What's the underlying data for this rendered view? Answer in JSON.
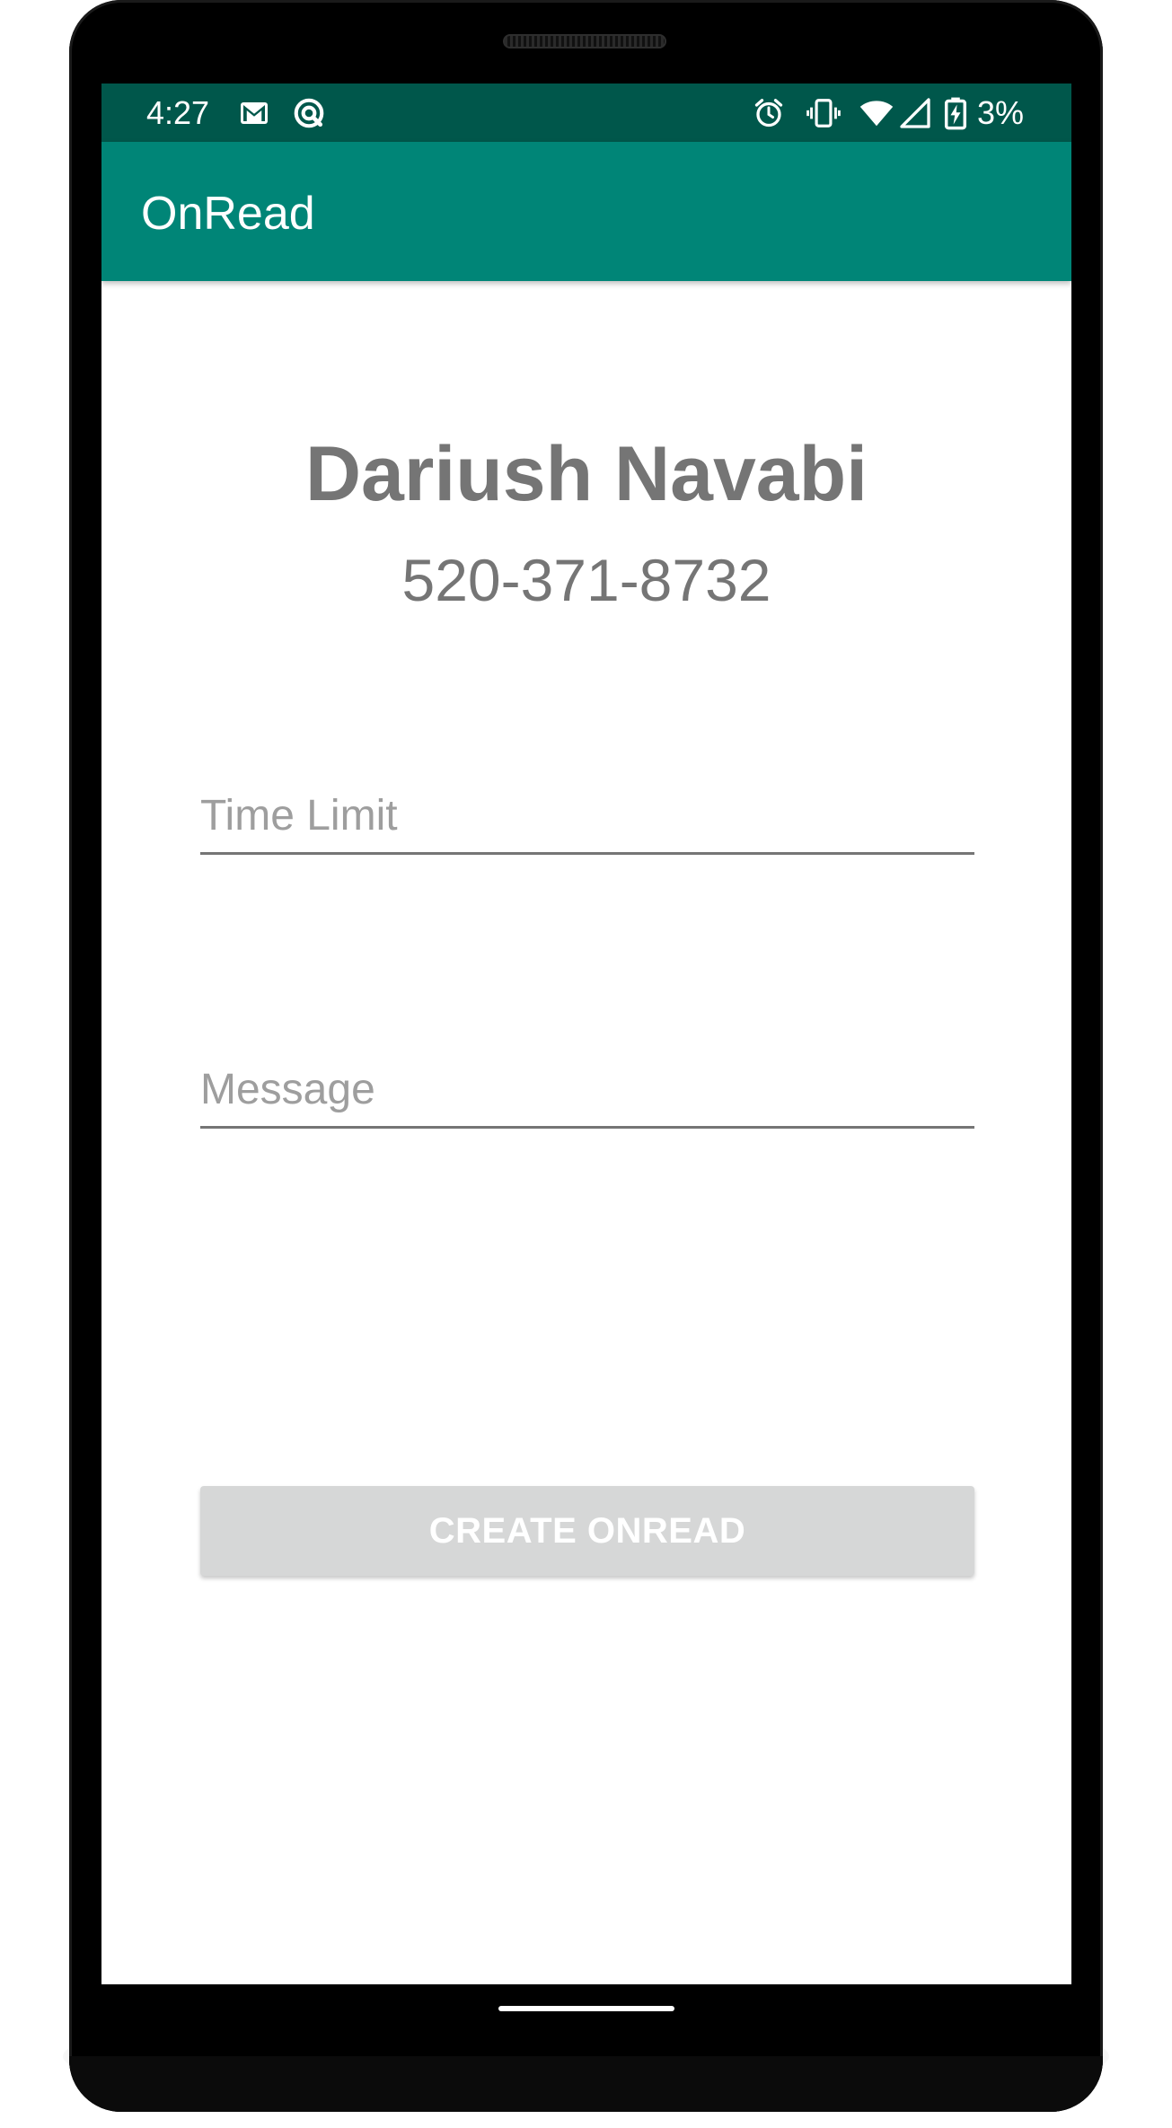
{
  "status_bar": {
    "time": "4:27",
    "battery_percent": "3%",
    "left_icons": [
      "gmail-icon",
      "sync-icon"
    ],
    "right_icons": [
      "alarm-icon",
      "vibrate-icon",
      "wifi-icon",
      "signal-icon",
      "battery-charging-icon"
    ],
    "background_color": "#00574b"
  },
  "app_bar": {
    "title": "OnRead",
    "background_color": "#008577"
  },
  "contact": {
    "name": "Dariush Navabi",
    "phone": "520-371-8732"
  },
  "form": {
    "time_limit": {
      "placeholder": "Time Limit",
      "value": ""
    },
    "message": {
      "placeholder": "Message",
      "value": ""
    },
    "create_button_label": "CREATE ONREAD",
    "create_button_enabled": false
  }
}
